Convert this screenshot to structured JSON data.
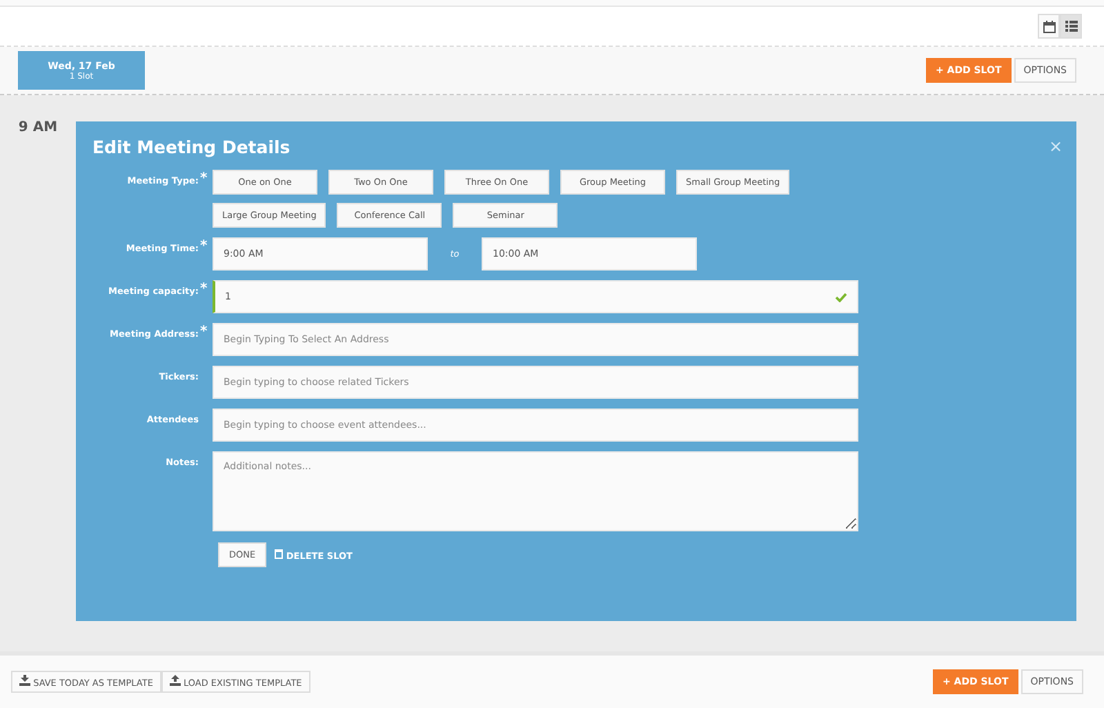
{
  "view_toggle": [
    {
      "kind": "calendar",
      "selected": false
    },
    {
      "kind": "list",
      "selected": true
    }
  ],
  "day_tab": {
    "date": "Wed, 17 Feb",
    "slots": "1 Slot",
    "selected": true
  },
  "top_actions": {
    "add_slot": "+ ADD SLOT",
    "options": "OPTIONS"
  },
  "time_label": "9 AM",
  "dialog": {
    "title": "Edit Meeting Details",
    "close": "×",
    "meeting_type": {
      "label": "Meeting Type:",
      "required_mark": "*",
      "options": [
        "One on One",
        "Two On One",
        "Three On One",
        "Group Meeting",
        "Small Group Meeting",
        "Large Group Meeting",
        "Conference Call",
        "Seminar"
      ]
    },
    "meeting_time": {
      "label": "Meeting Time:",
      "required_mark": "*",
      "start": "9:00 AM",
      "separator": "to",
      "end": "10:00 AM"
    },
    "fields": [
      {
        "kind": "input",
        "label": "Meeting capacity:",
        "required_mark": "*",
        "value": "1",
        "valid": true
      },
      {
        "kind": "input",
        "label": "Meeting Address:",
        "required_mark": "*",
        "placeholder": "Begin Typing To Select An Address",
        "valid": false
      },
      {
        "kind": "input",
        "label": "Tickers:",
        "placeholder": "Begin typing to choose related Tickers",
        "valid": false
      },
      {
        "kind": "input",
        "label": "Attendees",
        "placeholder": "Begin typing to choose event attendees...",
        "valid": false
      },
      {
        "kind": "textarea",
        "label": "Notes:",
        "placeholder": "Additional notes..."
      }
    ],
    "done": "DONE",
    "delete": "DELETE SLOT"
  },
  "footer": {
    "save_template": "SAVE TODAY AS TEMPLATE",
    "load_template": "LOAD EXISTING TEMPLATE",
    "add_slot": "+ ADD SLOT",
    "options": "OPTIONS"
  }
}
